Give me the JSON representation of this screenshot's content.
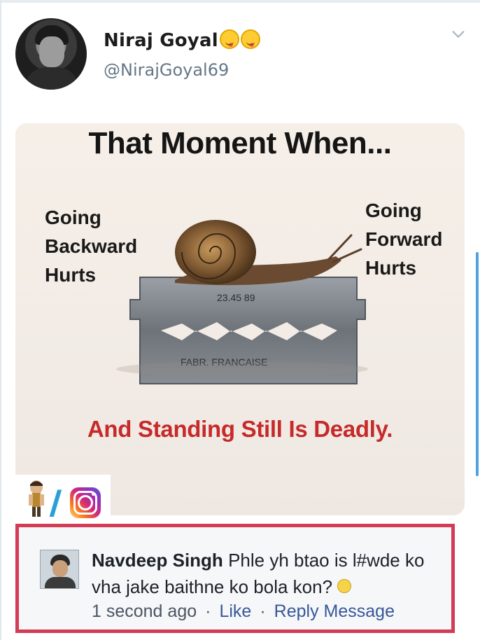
{
  "tweet": {
    "display_name": "Niraj Goyal",
    "handle": "@NirajGoyal69"
  },
  "meme": {
    "title": "That Moment When...",
    "left_text": [
      "Going",
      "Backward",
      "Hurts"
    ],
    "right_text": [
      "Going",
      "Forward",
      "Hurts"
    ],
    "tagline": "And Standing Still Is Deadly.",
    "blade_text_top": "23.45  89",
    "blade_text_bottom": "FABR. FRANCAISE"
  },
  "comment": {
    "author": "Navdeep Singh",
    "text": "Phle yh btao is l#wde ko vha jake baithne ko bola kon?",
    "time": "1 second ago",
    "like": "Like",
    "reply": "Reply",
    "message": "Message"
  },
  "colors": {
    "tagline": "#c62a2a",
    "highlight_border": "#d33c55",
    "handle": "#657786",
    "link": "#385898"
  },
  "icons": {
    "menu": "chevron-down-icon",
    "emoji": "yum-face-emoji",
    "instagram": "instagram-icon"
  }
}
